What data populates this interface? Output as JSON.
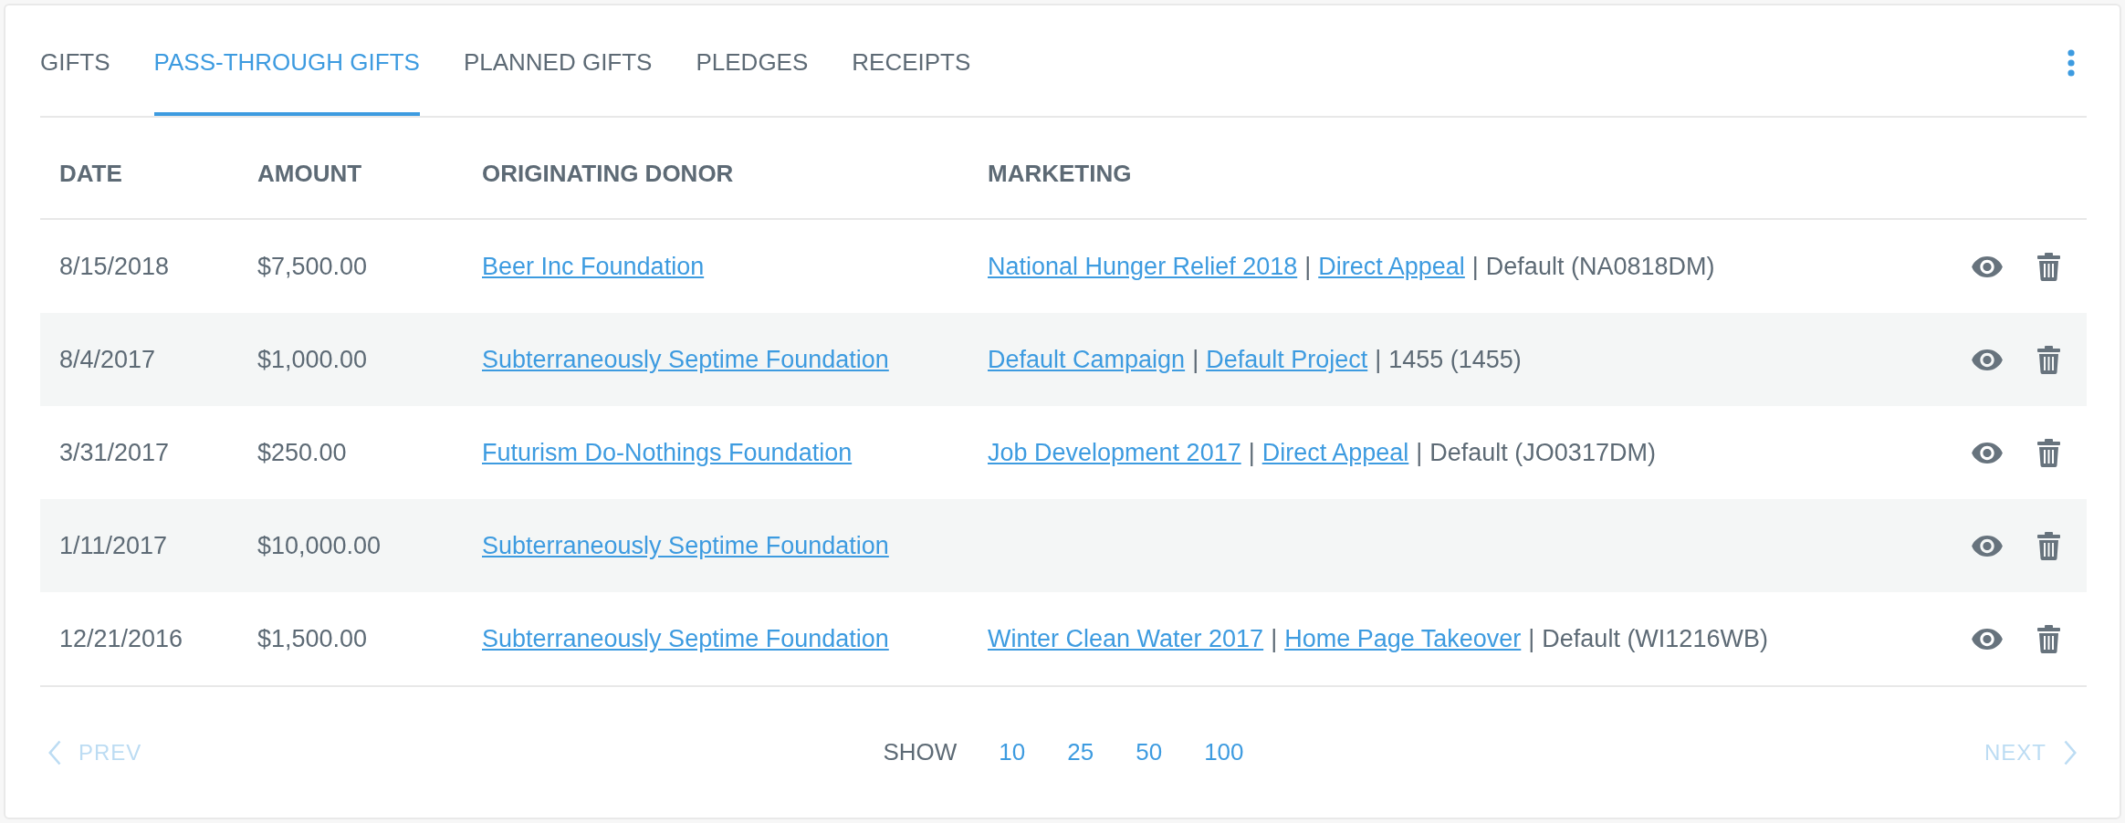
{
  "tabs": [
    {
      "label": "GIFTS",
      "selected": false
    },
    {
      "label": "PASS-THROUGH GIFTS",
      "selected": true
    },
    {
      "label": "PLANNED GIFTS",
      "selected": false
    },
    {
      "label": "PLEDGES",
      "selected": false
    },
    {
      "label": "RECEIPTS",
      "selected": false
    }
  ],
  "table": {
    "columns": [
      "DATE",
      "AMOUNT",
      "ORIGINATING DONOR",
      "MARKETING"
    ],
    "rows": [
      {
        "date": "8/15/2018",
        "amount": "$7,500.00",
        "originating_donor": "Beer Inc Foundation",
        "marketing": [
          {
            "kind": "link",
            "text": "National Hunger Relief 2018"
          },
          {
            "kind": "separator",
            "text": "|"
          },
          {
            "kind": "link",
            "text": "Direct Appeal"
          },
          {
            "kind": "separator",
            "text": "|"
          },
          {
            "kind": "text",
            "text": "Default (NA0818DM)"
          }
        ]
      },
      {
        "date": "8/4/2017",
        "amount": "$1,000.00",
        "originating_donor": "Subterraneously Septime Foundation",
        "marketing": [
          {
            "kind": "link",
            "text": "Default Campaign"
          },
          {
            "kind": "separator",
            "text": "|"
          },
          {
            "kind": "link",
            "text": "Default Project"
          },
          {
            "kind": "separator",
            "text": "|"
          },
          {
            "kind": "text",
            "text": "1455 (1455)"
          }
        ]
      },
      {
        "date": "3/31/2017",
        "amount": "$250.00",
        "originating_donor": "Futurism Do-Nothings Foundation",
        "marketing": [
          {
            "kind": "link",
            "text": "Job Development 2017"
          },
          {
            "kind": "separator",
            "text": "|"
          },
          {
            "kind": "link",
            "text": "Direct Appeal"
          },
          {
            "kind": "separator",
            "text": "|"
          },
          {
            "kind": "text",
            "text": "Default (JO0317DM)"
          }
        ]
      },
      {
        "date": "1/11/2017",
        "amount": "$10,000.00",
        "originating_donor": "Subterraneously Septime Foundation"
      },
      {
        "date": "12/21/2016",
        "amount": "$1,500.00",
        "originating_donor": "Subterraneously Septime Foundation",
        "marketing": [
          {
            "kind": "link",
            "text": "Winter Clean Water 2017"
          },
          {
            "kind": "separator",
            "text": "|"
          },
          {
            "kind": "link",
            "text": "Home Page Takeover"
          },
          {
            "kind": "separator",
            "text": "|"
          },
          {
            "kind": "text",
            "text": "Default (WI1216WB)"
          }
        ]
      }
    ]
  },
  "pagination": {
    "prev": {
      "label": "PREV",
      "disabled": true
    },
    "show_label": "SHOW",
    "page_sizes": [
      "10",
      "25",
      "50",
      "100"
    ],
    "next": {
      "label": "NEXT",
      "disabled": true
    }
  }
}
